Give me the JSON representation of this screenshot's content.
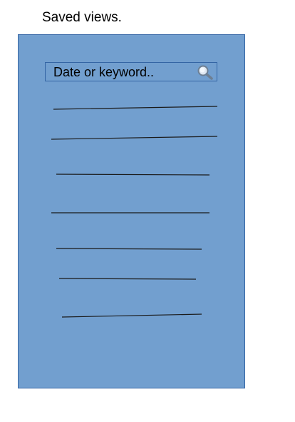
{
  "title": "Saved views.",
  "search": {
    "placeholder": "Date or keyword..",
    "icon": "search-icon"
  },
  "list": {
    "item_count": 7,
    "item_content": "placeholder-line"
  },
  "colors": {
    "panel_fill": "#729fcf",
    "panel_border": "#3465a4",
    "line": "#1a1a1a"
  }
}
